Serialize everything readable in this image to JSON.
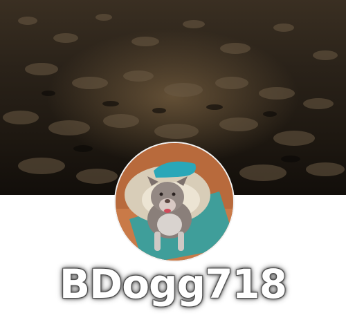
{
  "profile": {
    "username": "BDogg718"
  },
  "icons": {
    "cover": "wet-pavement-photo",
    "avatar": "dog-photo"
  },
  "colors": {
    "page_background": "#ffffff",
    "username_text": "#ffffff"
  }
}
